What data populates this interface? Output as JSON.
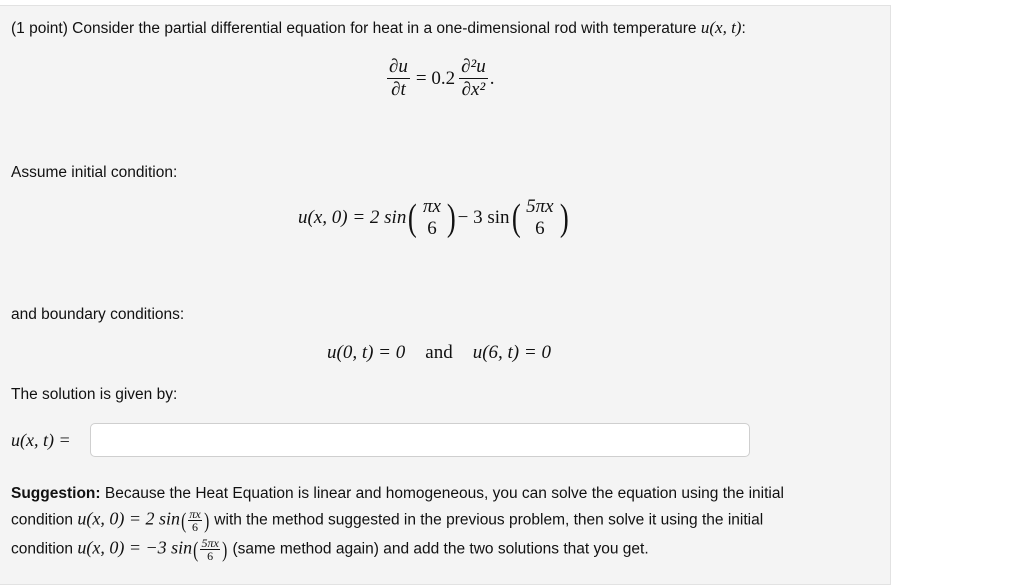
{
  "problem": {
    "intro": "(1 point) Consider the partial differential equation for heat in a one-dimensional rod with temperature ",
    "intro_math": "u(x, t)",
    "intro_end": ":",
    "pde": {
      "lhs_num": "∂u",
      "lhs_den": "∂t",
      "equals": "= 0.2",
      "rhs_num": "∂²u",
      "rhs_den": "∂x²",
      "end": "."
    },
    "initial_label": "Assume initial condition:",
    "initial": {
      "lhs": "u(x, 0) = 2 sin",
      "f1_num": "πx",
      "f1_den": "6",
      "mid": " − 3 sin",
      "f2_num": "5πx",
      "f2_den": "6"
    },
    "boundary_label": "and boundary conditions:",
    "boundary": {
      "left": "u(0, t) = 0",
      "and": "and",
      "right": "u(6, t) = 0"
    },
    "solution_label": "The solution is given by:",
    "answer_label": "u(x, t) =",
    "answer_value": "",
    "suggestion": {
      "bold": "Suggestion:",
      "line1": " Because the Heat Equation is linear and homogeneous, you can solve the equation using the initial",
      "line2_a": "condition ",
      "line2_math": "u(x, 0) = 2 sin",
      "line2_num": "πx",
      "line2_den": "6",
      "line2_b": " with the method suggested in the previous problem, then solve it using the initial",
      "line3_a": "condition ",
      "line3_math": "u(x, 0) = −3 sin",
      "line3_num": "5πx",
      "line3_den": "6",
      "line3_b": " (same method again) and add the two solutions that you get."
    }
  }
}
